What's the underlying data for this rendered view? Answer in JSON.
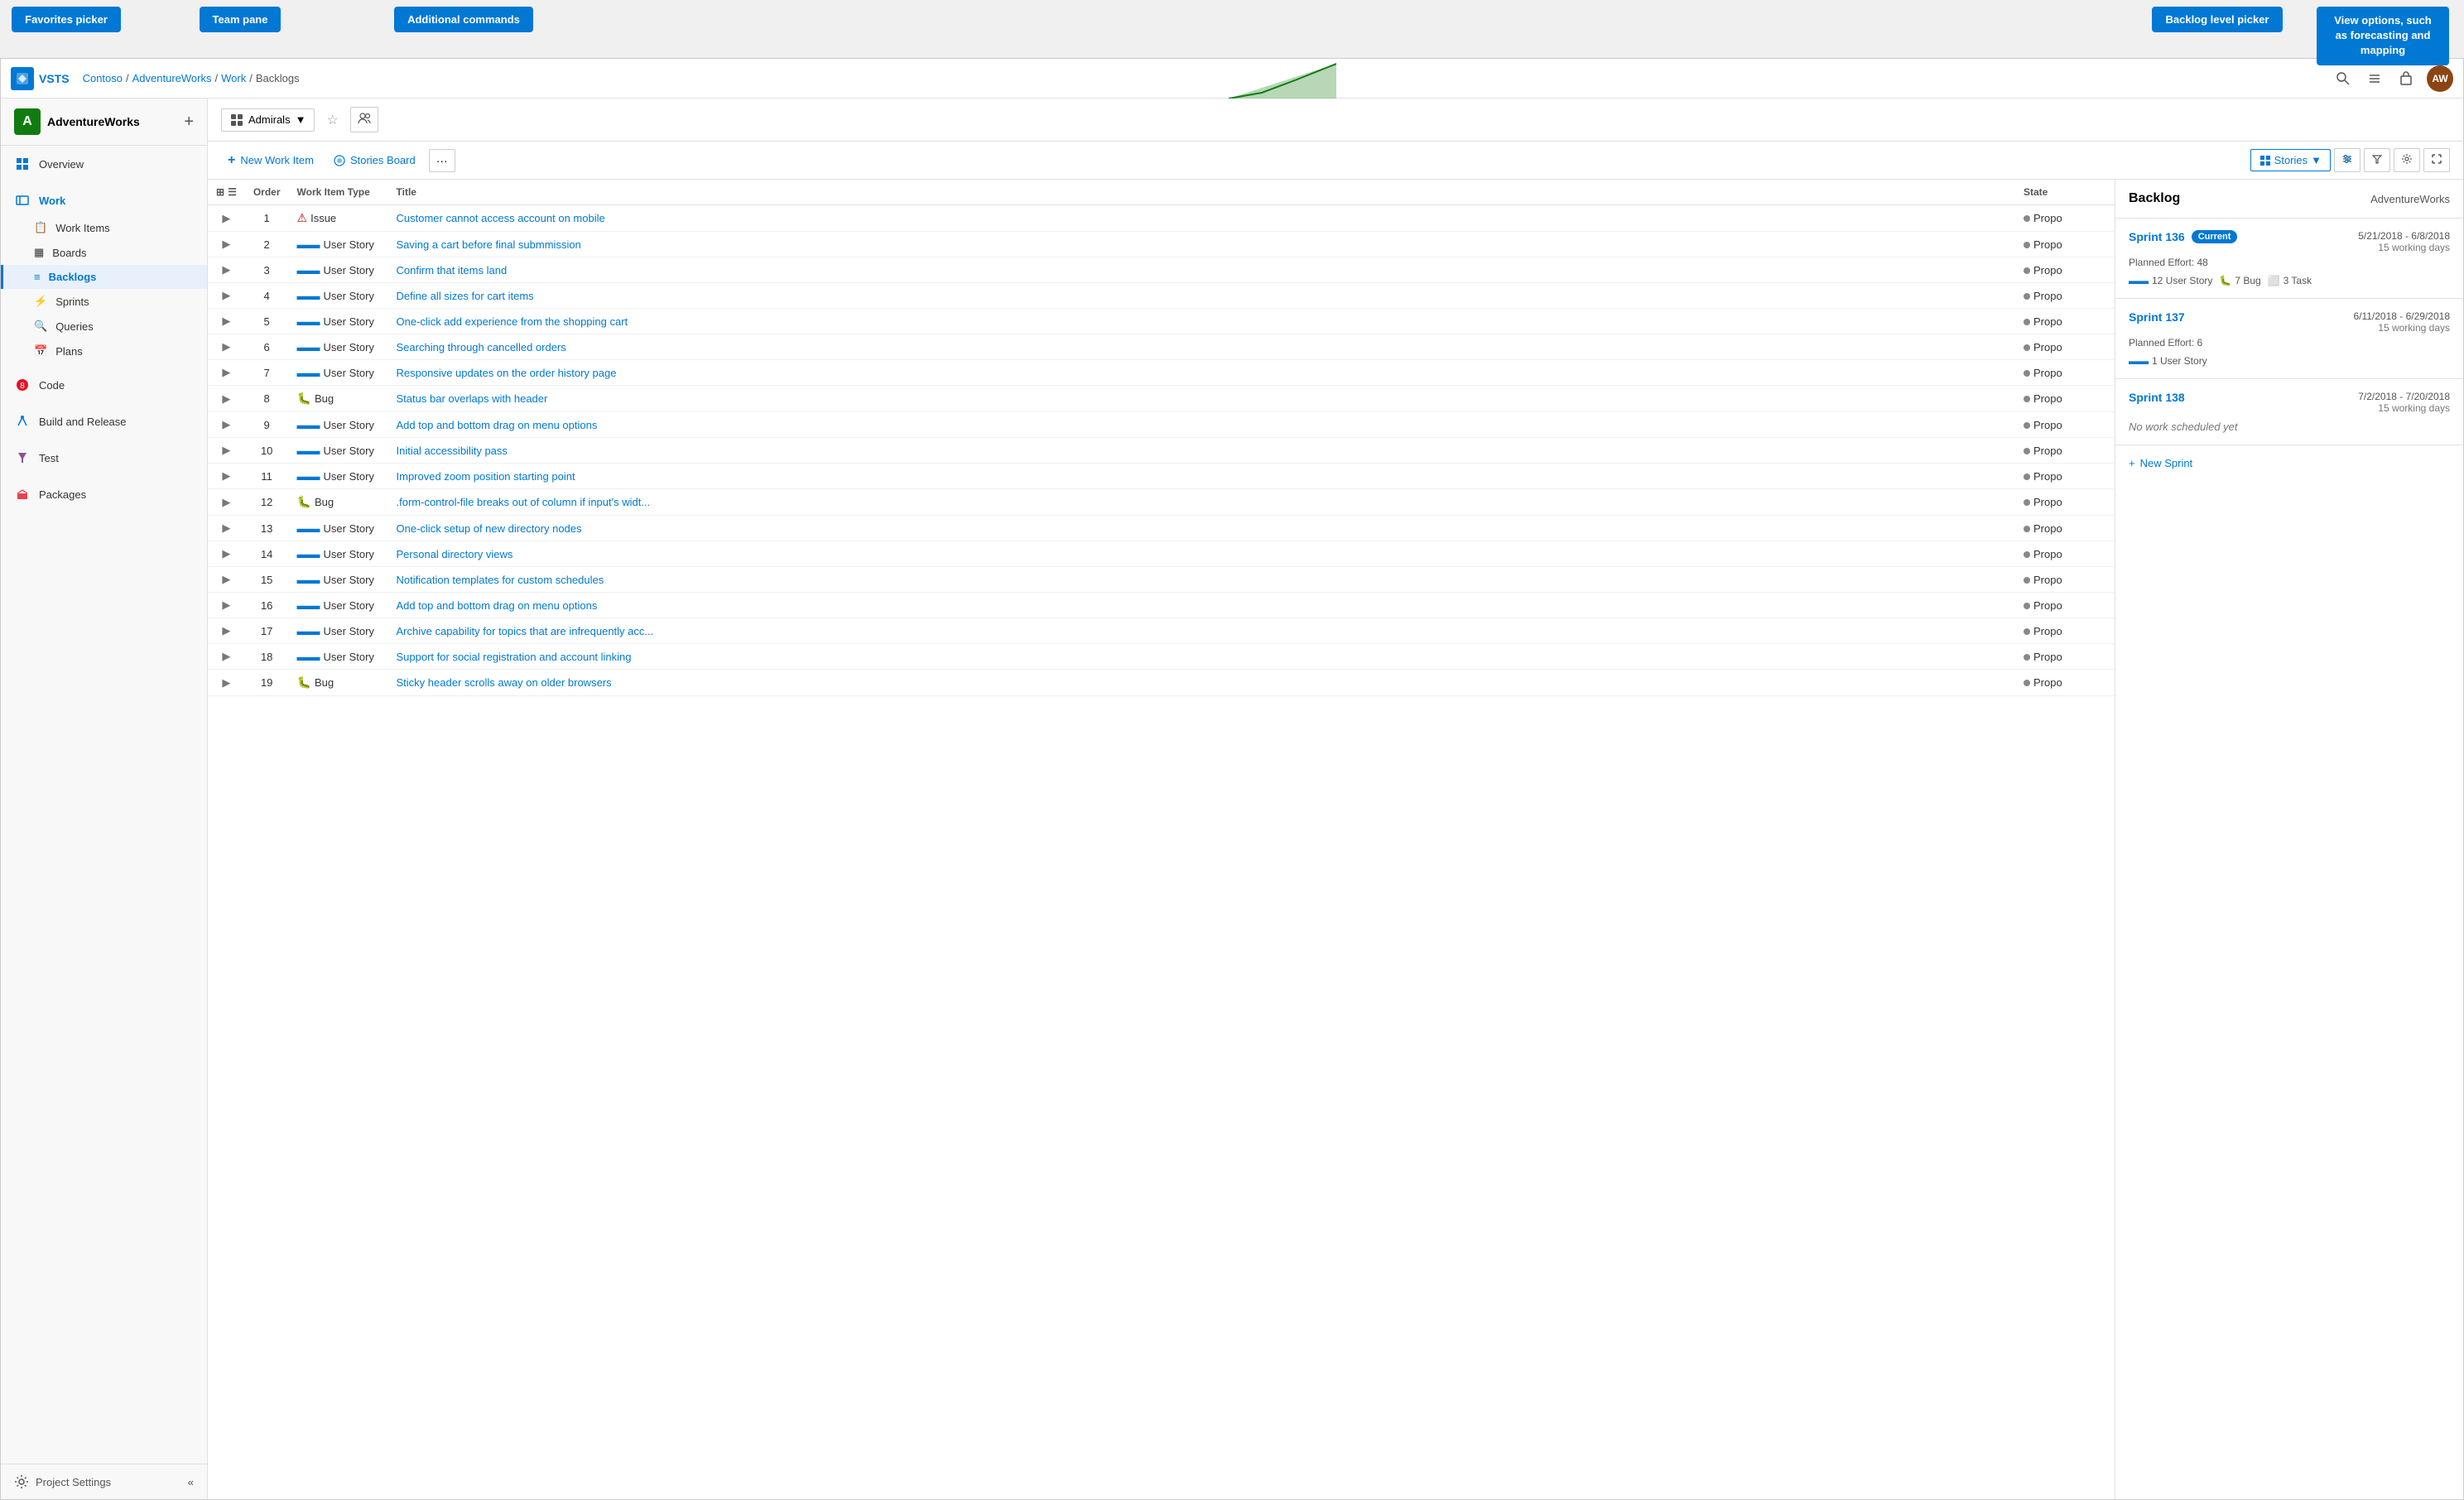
{
  "app": {
    "title": "VSTS",
    "logo_text": "V"
  },
  "breadcrumb": {
    "items": [
      "Contoso",
      "AdventureWorks",
      "Work",
      "Backlogs"
    ]
  },
  "tooltip_bar": {
    "favorites_picker": "Favorites picker",
    "team_pane": "Team pane",
    "additional_commands": "Additional commands",
    "backlog_level_picker": "Backlog level picker",
    "view_options": "View options, such as forecasting and mapping"
  },
  "project": {
    "name": "AdventureWorks",
    "avatar_letter": "A"
  },
  "sidebar": {
    "overview": "Overview",
    "work": "Work",
    "work_items": "Work Items",
    "boards": "Boards",
    "backlogs": "Backlogs",
    "sprints": "Sprints",
    "queries": "Queries",
    "plans": "Plans",
    "code": "Code",
    "build_release": "Build and Release",
    "test": "Test",
    "packages": "Packages",
    "project_settings": "Project Settings"
  },
  "toolbar": {
    "team_name": "Admirals",
    "team_dropdown_icon": "▼",
    "stories_label": "Stories",
    "new_work_item": "New Work Item",
    "stories_board": "Stories Board",
    "more_label": "···"
  },
  "table": {
    "headers": [
      "",
      "Order",
      "Work Item Type",
      "Title",
      "State"
    ],
    "rows": [
      {
        "order": 1,
        "type": "Issue",
        "type_icon": "issue",
        "title": "Customer cannot access account on mobile",
        "state": "Propo"
      },
      {
        "order": 2,
        "type": "User Story",
        "type_icon": "story",
        "title": "Saving a cart before final submmission",
        "state": "Propo"
      },
      {
        "order": 3,
        "type": "User Story",
        "type_icon": "story",
        "title": "Confirm that items land",
        "state": "Propo"
      },
      {
        "order": 4,
        "type": "User Story",
        "type_icon": "story",
        "title": "Define all sizes for cart items",
        "state": "Propo"
      },
      {
        "order": 5,
        "type": "User Story",
        "type_icon": "story",
        "title": "One-click add experience from the shopping cart",
        "state": "Propo"
      },
      {
        "order": 6,
        "type": "User Story",
        "type_icon": "story",
        "title": "Searching through cancelled orders",
        "state": "Propo"
      },
      {
        "order": 7,
        "type": "User Story",
        "type_icon": "story",
        "title": "Responsive updates on the order history page",
        "state": "Propo"
      },
      {
        "order": 8,
        "type": "Bug",
        "type_icon": "bug",
        "title": "Status bar overlaps with header",
        "state": "Propo"
      },
      {
        "order": 9,
        "type": "User Story",
        "type_icon": "story",
        "title": "Add top and bottom drag on menu options",
        "state": "Propo"
      },
      {
        "order": 10,
        "type": "User Story",
        "type_icon": "story",
        "title": "Initial accessibility pass",
        "state": "Propo"
      },
      {
        "order": 11,
        "type": "User Story",
        "type_icon": "story",
        "title": "Improved zoom position starting point",
        "state": "Propo"
      },
      {
        "order": 12,
        "type": "Bug",
        "type_icon": "bug",
        "title": ".form-control-file breaks out of column if input's widt...",
        "state": "Propo"
      },
      {
        "order": 13,
        "type": "User Story",
        "type_icon": "story",
        "title": "One-click setup of new directory nodes",
        "state": "Propo"
      },
      {
        "order": 14,
        "type": "User Story",
        "type_icon": "story",
        "title": "Personal directory views",
        "state": "Propo"
      },
      {
        "order": 15,
        "type": "User Story",
        "type_icon": "story",
        "title": "Notification templates for custom schedules",
        "state": "Propo"
      },
      {
        "order": 16,
        "type": "User Story",
        "type_icon": "story",
        "title": "Add top and bottom drag on menu options",
        "state": "Propo"
      },
      {
        "order": 17,
        "type": "User Story",
        "type_icon": "story",
        "title": "Archive capability for topics that are infrequently acc...",
        "state": "Propo"
      },
      {
        "order": 18,
        "type": "User Story",
        "type_icon": "story",
        "title": "Support for social registration and account linking",
        "state": "Propo"
      },
      {
        "order": 19,
        "type": "Bug",
        "type_icon": "bug",
        "title": "Sticky header scrolls away on older browsers",
        "state": "Propo"
      }
    ]
  },
  "backlog_panel": {
    "title": "Backlog",
    "org": "AdventureWorks",
    "sprints": [
      {
        "name": "Sprint 136",
        "is_current": true,
        "current_label": "Current",
        "dates": "5/21/2018 - 6/8/2018",
        "working_days": "15 working days",
        "effort_label": "Planned Effort: 48",
        "tags": [
          {
            "icon": "story",
            "count": 12,
            "label": "User Story"
          },
          {
            "icon": "bug",
            "count": 7,
            "label": "Bug"
          },
          {
            "icon": "task",
            "count": 3,
            "label": "Task"
          }
        ]
      },
      {
        "name": "Sprint 137",
        "is_current": false,
        "dates": "6/11/2018 - 6/29/2018",
        "working_days": "15 working days",
        "effort_label": "Planned Effort: 6",
        "tags": [
          {
            "icon": "story",
            "count": 1,
            "label": "User Story"
          }
        ]
      },
      {
        "name": "Sprint 138",
        "is_current": false,
        "dates": "7/2/2018 - 7/20/2018",
        "working_days": "15 working days",
        "effort_label": "",
        "no_work_text": "No work scheduled yet",
        "tags": []
      }
    ],
    "new_sprint_label": "+ New Sprint"
  }
}
